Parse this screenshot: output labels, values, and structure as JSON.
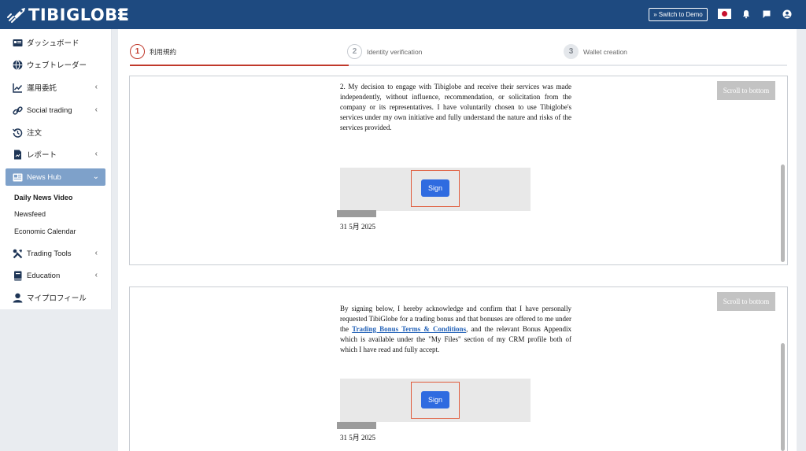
{
  "header": {
    "logo_text": "TIBIGLOBE",
    "switch_demo_label": "Switch to Demo",
    "switch_demo_icon": "»"
  },
  "sidebar": {
    "items": [
      {
        "label": "ダッシュボード",
        "icon": "dashboard-icon",
        "has_chevron": false
      },
      {
        "label": "ウェブトレーダー",
        "icon": "globe-icon",
        "has_chevron": false
      },
      {
        "label": "運用委託",
        "icon": "chart-line-icon",
        "has_chevron": true
      },
      {
        "label": "Social trading",
        "icon": "link-icon",
        "has_chevron": true
      },
      {
        "label": "注文",
        "icon": "history-icon",
        "has_chevron": false
      },
      {
        "label": "レポート",
        "icon": "report-icon",
        "has_chevron": true
      },
      {
        "label": "News Hub",
        "icon": "newspaper-icon",
        "has_chevron": true
      },
      {
        "label": "Trading Tools",
        "icon": "tools-icon",
        "has_chevron": true
      },
      {
        "label": "Education",
        "icon": "book-icon",
        "has_chevron": true
      },
      {
        "label": "マイプロフィール",
        "icon": "user-icon",
        "has_chevron": false
      }
    ],
    "news_hub_subitems": [
      "Daily News Video",
      "Newsfeed",
      "Economic Calendar"
    ],
    "chevron_right": "‹",
    "chevron_down": "⌄"
  },
  "stepper": {
    "steps": [
      {
        "number": "1",
        "label": "利用規約"
      },
      {
        "number": "2",
        "label": "Identity verification"
      },
      {
        "number": "3",
        "label": "Wallet creation"
      }
    ]
  },
  "documents": [
    {
      "text": "2.   My decision to engage with Tibiglobe and receive their services was made independently, without influence, recommendation, or solicitation from the company or its representatives. I have voluntarily chosen to use Tibiglobe's services under my own initiative and fully understand the nature and risks of the services provided.",
      "scroll_button": "Scroll to bottom",
      "sign_button": "Sign",
      "date": "31 5月 2025"
    },
    {
      "text_before_link": "By signing below, I hereby acknowledge and confirm that I have personally requested TibiGlobe for a trading bonus and that bonuses are offered to me under the ",
      "link_text": "Trading Bonus Terms & Conditions",
      "text_after_link": ", and the relevant Bonus Appendix which is available under the \"My Files\" section of my CRM profile both of which I have read and fully accept.",
      "scroll_button": "Scroll to bottom",
      "sign_button": "Sign",
      "date": "31 5月 2025"
    }
  ]
}
